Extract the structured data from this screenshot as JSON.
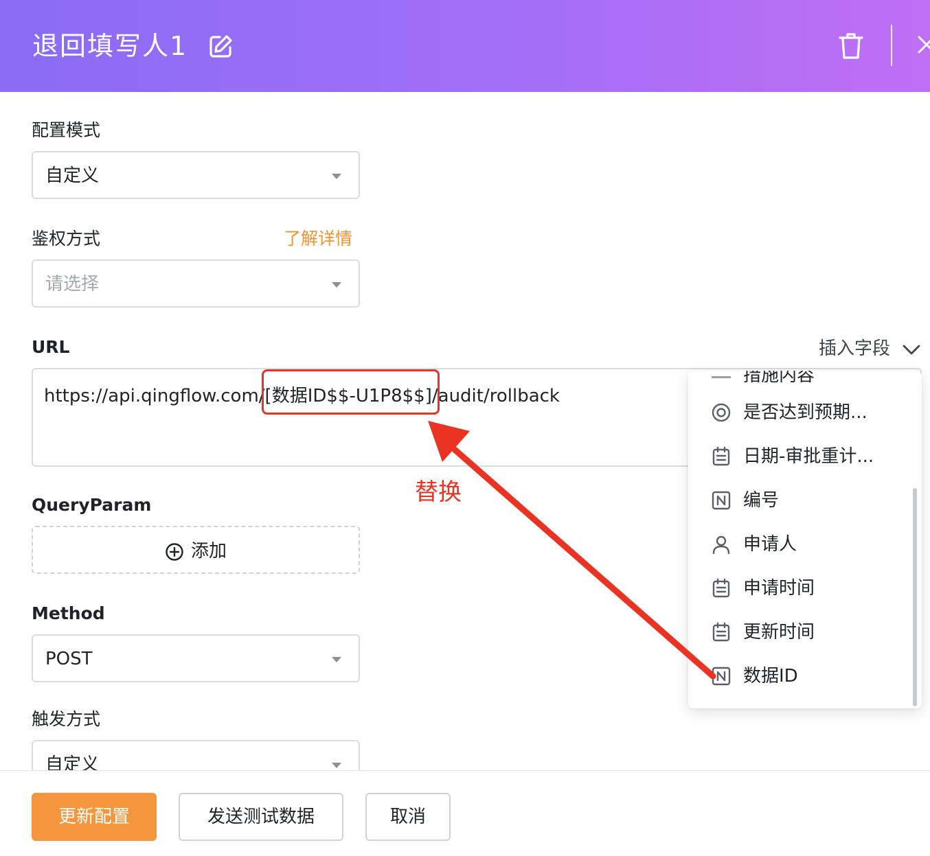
{
  "header": {
    "title": "退回填写人1",
    "colors": {
      "gradient_start": "#8a6cf6",
      "gradient_end": "#c06ef6"
    },
    "icons": [
      "edit-icon",
      "trash-icon",
      "close-icon"
    ]
  },
  "form": {
    "config_mode": {
      "label": "配置模式",
      "value": "自定义"
    },
    "auth_mode": {
      "label": "鉴权方式",
      "link": "了解详情",
      "placeholder": "请选择"
    },
    "url": {
      "label": "URL",
      "prefix": "https://api.qingflow.com/",
      "token": "[数据ID$$-U1P8$$]",
      "suffix": "/audit/rollback",
      "insert_field": "插入字段"
    },
    "query_param": {
      "label": "QueryParam",
      "add_label": "添加"
    },
    "method": {
      "label": "Method",
      "value": "POST"
    },
    "trigger": {
      "label": "触发方式",
      "value": "自定义"
    }
  },
  "field_dropdown": {
    "items": [
      {
        "label": "措施内容",
        "icon": "text-icon"
      },
      {
        "label": "是否达到预期...",
        "icon": "radio-icon"
      },
      {
        "label": "日期-审批重计...",
        "icon": "calendar-icon"
      },
      {
        "label": "编号",
        "icon": "number-icon"
      },
      {
        "label": "申请人",
        "icon": "person-icon"
      },
      {
        "label": "申请时间",
        "icon": "calendar-icon"
      },
      {
        "label": "更新时间",
        "icon": "calendar-icon"
      },
      {
        "label": "数据ID",
        "icon": "number-icon"
      }
    ]
  },
  "annotation": {
    "text": "替换",
    "color": "#ea3323"
  },
  "footer": {
    "update_label": "更新配置",
    "test_label": "发送测试数据",
    "cancel_label": "取消",
    "accent": "#f5953d"
  }
}
